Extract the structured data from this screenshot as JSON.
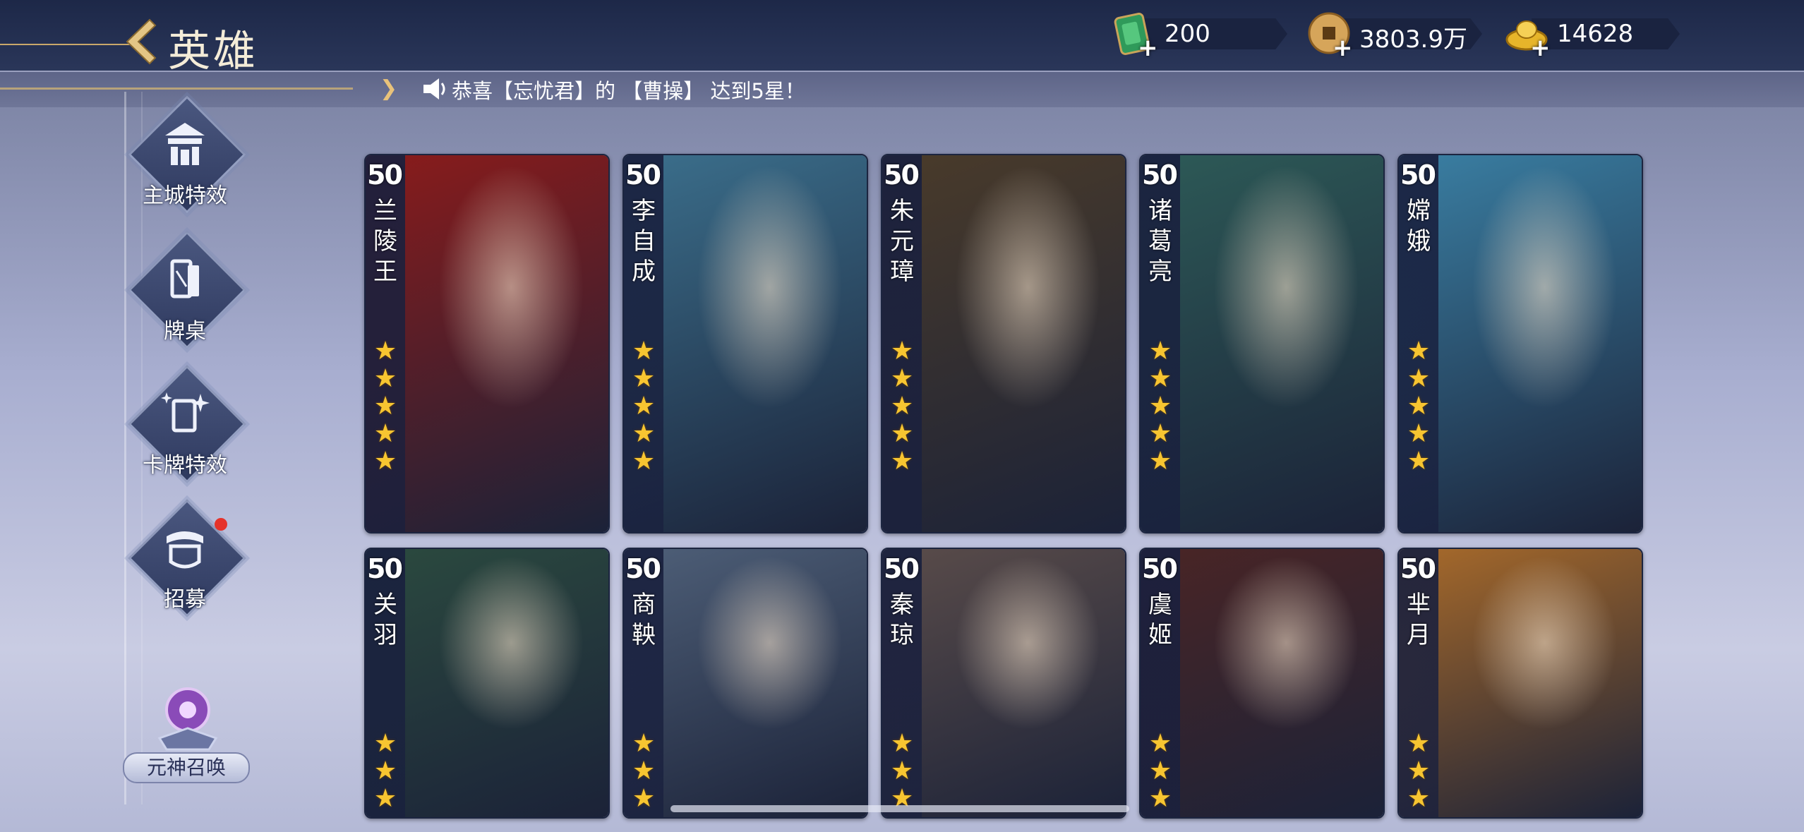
{
  "header": {
    "title": "英雄",
    "currencies": [
      {
        "icon": "jade-ticket-icon",
        "value": "200"
      },
      {
        "icon": "copper-coin-icon",
        "value": "3803.9万"
      },
      {
        "icon": "gold-ingot-icon",
        "value": "14628"
      }
    ]
  },
  "notice": {
    "text": "恭喜【忘忧君】的 【曹操】 达到5星！"
  },
  "sidebar": {
    "items": [
      {
        "label": "主城特效",
        "icon": "city-gate-icon"
      },
      {
        "label": "牌桌",
        "icon": "card-table-icon"
      },
      {
        "label": "卡牌特效",
        "icon": "card-sparkle-icon"
      },
      {
        "label": "招募",
        "icon": "recruit-banner-icon",
        "badge": "red-dot"
      }
    ],
    "summon_label": "元神召唤"
  },
  "heroes": [
    {
      "name": "兰\n陵\n王",
      "level": "50",
      "stars": 5,
      "color": "#8a1b1b"
    },
    {
      "name": "李\n自\n成",
      "level": "50",
      "stars": 5,
      "color": "#3b6f8c"
    },
    {
      "name": "朱\n元\n璋",
      "level": "50",
      "stars": 5,
      "color": "#4a3b2a"
    },
    {
      "name": "诸\n葛\n亮",
      "level": "50",
      "stars": 5,
      "color": "#2d5a57"
    },
    {
      "name": "嫦\n娥",
      "level": "50",
      "stars": 5,
      "color": "#3a7fa3"
    },
    {
      "name": "关\n羽",
      "level": "50",
      "stars": 3,
      "color": "#2b4a3f"
    },
    {
      "name": "商\n鞅",
      "level": "50",
      "stars": 3,
      "color": "#4e5f78"
    },
    {
      "name": "秦\n琼",
      "level": "50",
      "stars": 3,
      "color": "#5a4c4a"
    },
    {
      "name": "虞\n姬",
      "level": "50",
      "stars": 3,
      "color": "#4a2525"
    },
    {
      "name": "芈\n月",
      "level": "50",
      "stars": 3,
      "color": "#a86a2a"
    }
  ]
}
